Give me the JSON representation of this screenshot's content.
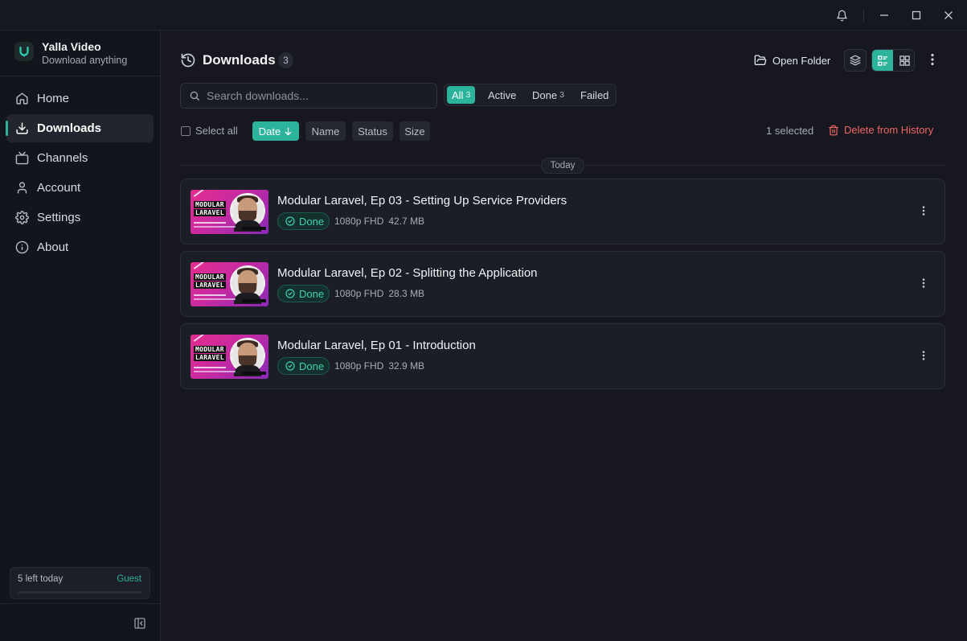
{
  "window": {
    "controls": [
      "bell-icon",
      "minimize-icon",
      "maximize-icon",
      "close-icon"
    ]
  },
  "app": {
    "name": "Yalla Video",
    "tagline": "Download anything",
    "accent": "#2bb39c"
  },
  "sidebar": {
    "items": [
      {
        "label": "Home",
        "icon": "home-icon"
      },
      {
        "label": "Downloads",
        "icon": "download-icon",
        "active": true
      },
      {
        "label": "Channels",
        "icon": "tv-icon"
      },
      {
        "label": "Account",
        "icon": "user-icon"
      },
      {
        "label": "Settings",
        "icon": "gear-icon"
      },
      {
        "label": "About",
        "icon": "info-icon"
      }
    ],
    "quota": {
      "left_text": "5 left today",
      "plan": "Guest",
      "progress": 0
    }
  },
  "header": {
    "title": "Downloads",
    "count": "3",
    "open_folder_label": "Open Folder"
  },
  "search": {
    "placeholder": "Search downloads...",
    "value": ""
  },
  "filters": [
    {
      "label": "All",
      "count": "3",
      "active": true
    },
    {
      "label": "Active",
      "count": ""
    },
    {
      "label": "Done",
      "count": "3"
    },
    {
      "label": "Failed",
      "count": ""
    }
  ],
  "toolbar": {
    "select_all_label": "Select all",
    "sort_buttons": [
      {
        "label": "Date",
        "active": true,
        "direction": "desc"
      },
      {
        "label": "Name"
      },
      {
        "label": "Status"
      },
      {
        "label": "Size"
      }
    ],
    "selected_text": "1 selected",
    "delete_label": "Delete from History"
  },
  "group_label": "Today",
  "downloads": [
    {
      "title": "Modular Laravel, Ep 03 - Setting Up Service Providers",
      "status": "Done",
      "quality": "1080p FHD",
      "size": "42.7 MB"
    },
    {
      "title": "Modular Laravel, Ep 02 - Splitting the Application",
      "status": "Done",
      "quality": "1080p FHD",
      "size": "28.3 MB"
    },
    {
      "title": "Modular Laravel, Ep 01 - Introduction",
      "status": "Done",
      "quality": "1080p FHD",
      "size": "32.9 MB"
    }
  ],
  "thumbnail_text": {
    "line1": "MODULAR",
    "line2": "LARAVEL"
  }
}
